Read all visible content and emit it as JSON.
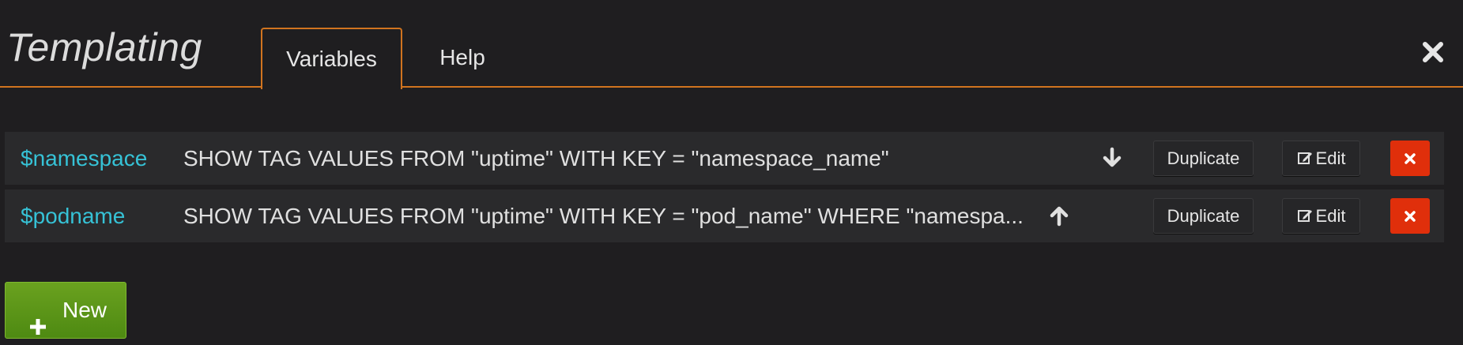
{
  "header": {
    "title": "Templating",
    "tabs": [
      {
        "label": "Variables",
        "active": true
      },
      {
        "label": "Help",
        "active": false
      }
    ],
    "close_icon": "close-icon"
  },
  "variables": [
    {
      "name": "$namespace",
      "query": "SHOW TAG VALUES FROM \"uptime\" WITH KEY = \"namespace_name\"",
      "move_icon": "arrow-down-icon",
      "duplicate_label": "Duplicate",
      "edit_label": "Edit",
      "delete_icon": "times-icon"
    },
    {
      "name": "$podname",
      "query": "SHOW TAG VALUES FROM \"uptime\" WITH KEY = \"pod_name\" WHERE \"namespa...",
      "move_icon": "arrow-up-icon",
      "duplicate_label": "Duplicate",
      "edit_label": "Edit",
      "delete_icon": "times-icon"
    }
  ],
  "new_button": {
    "label": "New",
    "icon": "plus-icon"
  },
  "colors": {
    "background": "#1f1e20",
    "accent": "#d1741f",
    "variable_name": "#36c2d6",
    "delete": "#e02f0b",
    "new": "#5a9718"
  }
}
